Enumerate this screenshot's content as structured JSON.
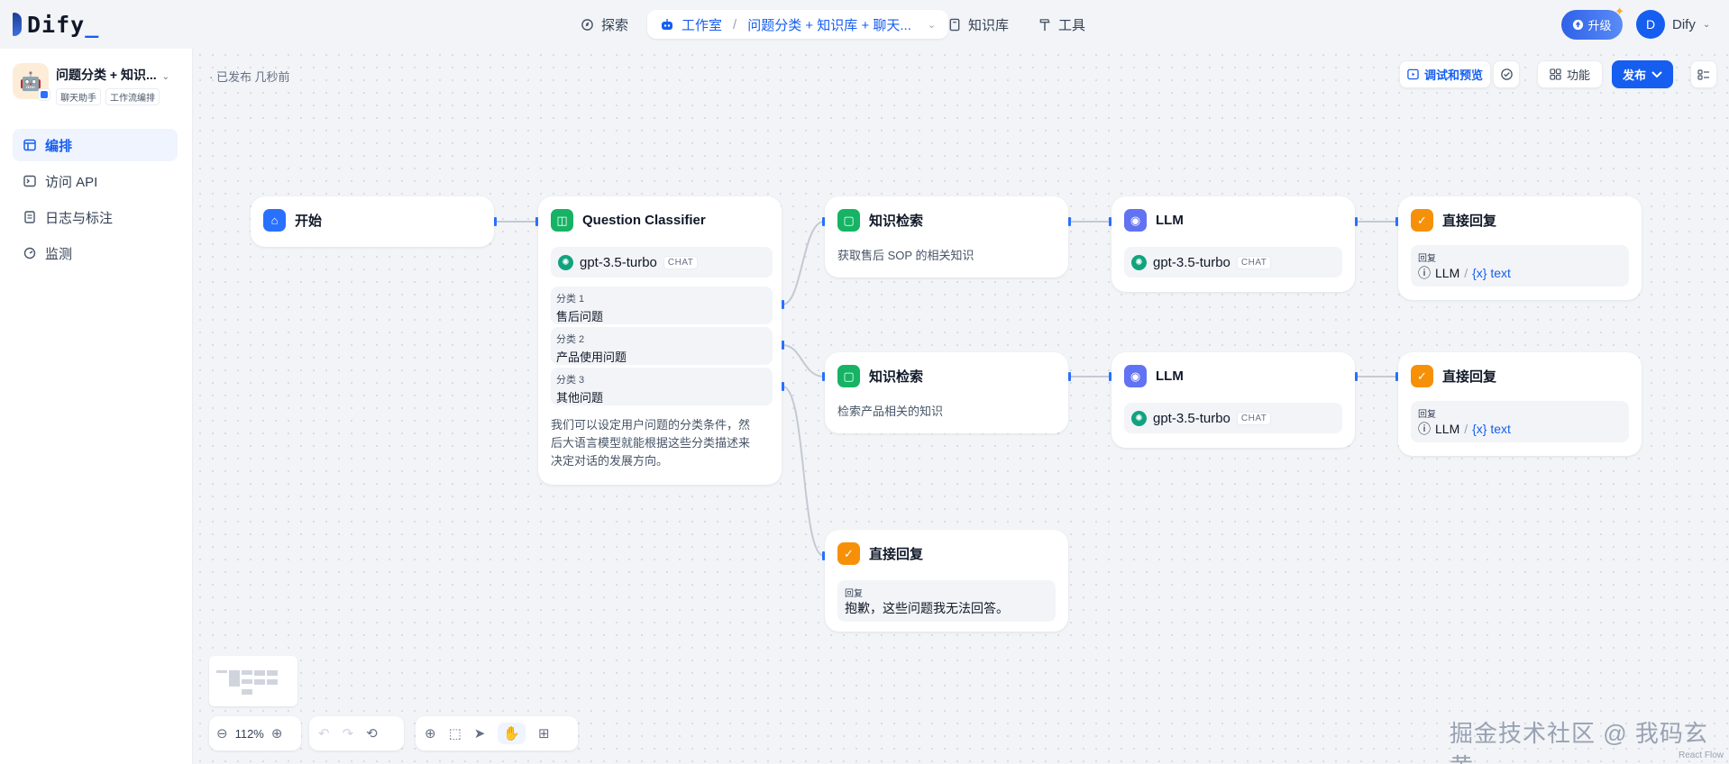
{
  "brand": {
    "name": "Dify",
    "underscore": "_"
  },
  "nav": {
    "explore": "探索",
    "studio": "工作室",
    "app_crumb": "问题分类 + 知识库 + 聊天...",
    "knowledge": "知识库",
    "tools": "工具"
  },
  "header": {
    "upgrade": "升级",
    "user_initial": "D",
    "user_name": "Dify"
  },
  "app": {
    "name": "问题分类 + 知识...",
    "tags": [
      "聊天助手",
      "工作流编排"
    ],
    "icon": "robot-emoji"
  },
  "sidebar": {
    "items": [
      {
        "label": "编排",
        "icon": "layout-icon",
        "active": true
      },
      {
        "label": "访问 API",
        "icon": "terminal-icon",
        "active": false
      },
      {
        "label": "日志与标注",
        "icon": "document-icon",
        "active": false
      },
      {
        "label": "监测",
        "icon": "monitor-icon",
        "active": false
      }
    ]
  },
  "toolbar": {
    "status": "· 已发布 几秒前",
    "debug_preview": "调试和预览",
    "features": "功能",
    "publish": "发布"
  },
  "nodes": {
    "start": {
      "title": "开始"
    },
    "classifier": {
      "title": "Question Classifier",
      "model": "gpt-3.5-turbo",
      "mode": "CHAT",
      "classes": [
        {
          "key": "分类 1",
          "value": "售后问题"
        },
        {
          "key": "分类 2",
          "value": "产品使用问题"
        },
        {
          "key": "分类 3",
          "value": "其他问题"
        }
      ],
      "desc_lines": [
        "我们可以设定用户问题的分类条件，然",
        "后大语言模型就能根据这些分类描述来",
        "决定对话的发展方向。"
      ]
    },
    "kr1": {
      "title": "知识检索",
      "desc": "获取售后 SOP 的相关知识"
    },
    "kr2": {
      "title": "知识检索",
      "desc": "检索产品相关的知识"
    },
    "llm1": {
      "title": "LLM",
      "model": "gpt-3.5-turbo",
      "mode": "CHAT"
    },
    "llm2": {
      "title": "LLM",
      "model": "gpt-3.5-turbo",
      "mode": "CHAT"
    },
    "ans1": {
      "title": "直接回复",
      "label": "回复",
      "src": "LLM",
      "slash": "/",
      "var": "{x} text"
    },
    "ans2": {
      "title": "直接回复",
      "label": "回复",
      "src": "LLM",
      "slash": "/",
      "var": "{x} text"
    },
    "ans3": {
      "title": "直接回复",
      "label": "回复",
      "text": "抱歉，这些问题我无法回答。"
    }
  },
  "zoom": "112%",
  "watermark": "掘金技术社区 @ 我码玄黄",
  "attribution": "React Flow"
}
